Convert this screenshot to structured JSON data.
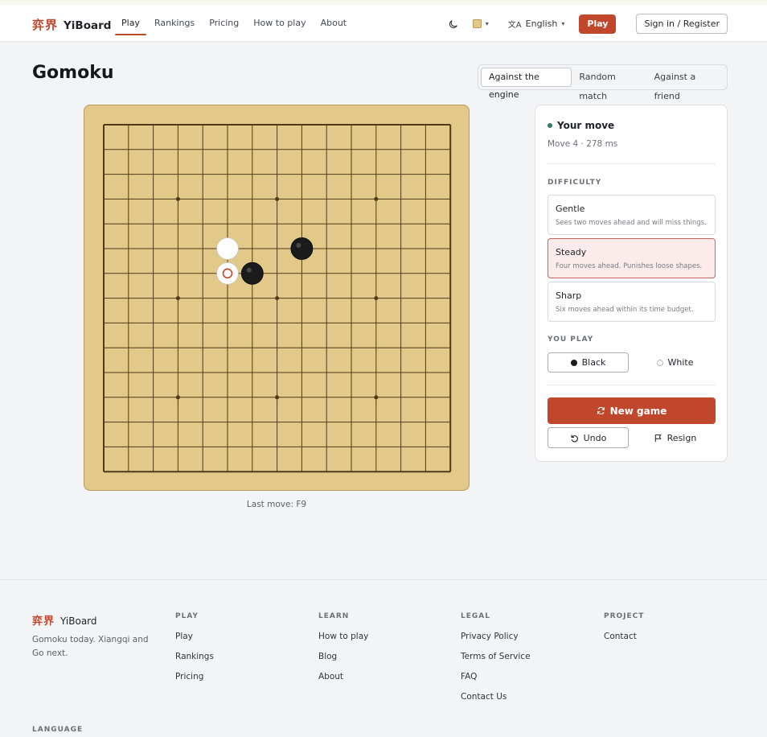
{
  "brand": {
    "cn": "弈界",
    "en": "YiBoard"
  },
  "nav": [
    {
      "label": "Play",
      "active": true
    },
    {
      "label": "Rankings"
    },
    {
      "label": "Pricing"
    },
    {
      "label": "How to play"
    },
    {
      "label": "About"
    }
  ],
  "header": {
    "language": "English",
    "play_label": "Play",
    "signin_label": "Sign in / Register"
  },
  "page": {
    "title": "Gomoku"
  },
  "modes": [
    "Against the engine",
    "Random match",
    "Against a friend"
  ],
  "board": {
    "size": 15,
    "star_points": [
      [
        3,
        3
      ],
      [
        3,
        7
      ],
      [
        3,
        11
      ],
      [
        7,
        3
      ],
      [
        7,
        7
      ],
      [
        7,
        11
      ],
      [
        11,
        3
      ],
      [
        11,
        7
      ],
      [
        11,
        11
      ]
    ],
    "stones": [
      {
        "color": "white",
        "col": 5,
        "row": 5
      },
      {
        "color": "black",
        "col": 8,
        "row": 5
      },
      {
        "color": "white",
        "col": 5,
        "row": 6,
        "last": true
      },
      {
        "color": "black",
        "col": 6,
        "row": 6
      }
    ],
    "colors": {
      "wood": "#e2c889",
      "line": "#4e3a17",
      "accent": "#c0472c"
    },
    "last_move_text": "Last move: F9"
  },
  "panel": {
    "status": "Your move",
    "move_info": "Move 4 · 278 ms",
    "difficulty_label": "DIFFICULTY",
    "difficulties": [
      {
        "name": "Gentle",
        "desc": "Sees two moves ahead and will miss things."
      },
      {
        "name": "Steady",
        "desc": "Four moves ahead. Punishes loose shapes.",
        "selected": true
      },
      {
        "name": "Sharp",
        "desc": "Six moves ahead within its time budget."
      }
    ],
    "you_play_label": "YOU PLAY",
    "sides": [
      "Black",
      "White"
    ],
    "new_game": "New game",
    "undo": "Undo",
    "resign": "Resign"
  },
  "footer": {
    "tagline": "Gomoku today. Xiangqi and Go next.",
    "columns": [
      {
        "title": "PLAY",
        "links": [
          "Play",
          "Rankings",
          "Pricing"
        ]
      },
      {
        "title": "LEARN",
        "links": [
          "How to play",
          "Blog",
          "About"
        ]
      },
      {
        "title": "LEGAL",
        "links": [
          "Privacy Policy",
          "Terms of Service",
          "FAQ",
          "Contact Us"
        ]
      },
      {
        "title": "PROJECT",
        "links": [
          "Contact"
        ]
      }
    ],
    "language_label": "LANGUAGE"
  }
}
